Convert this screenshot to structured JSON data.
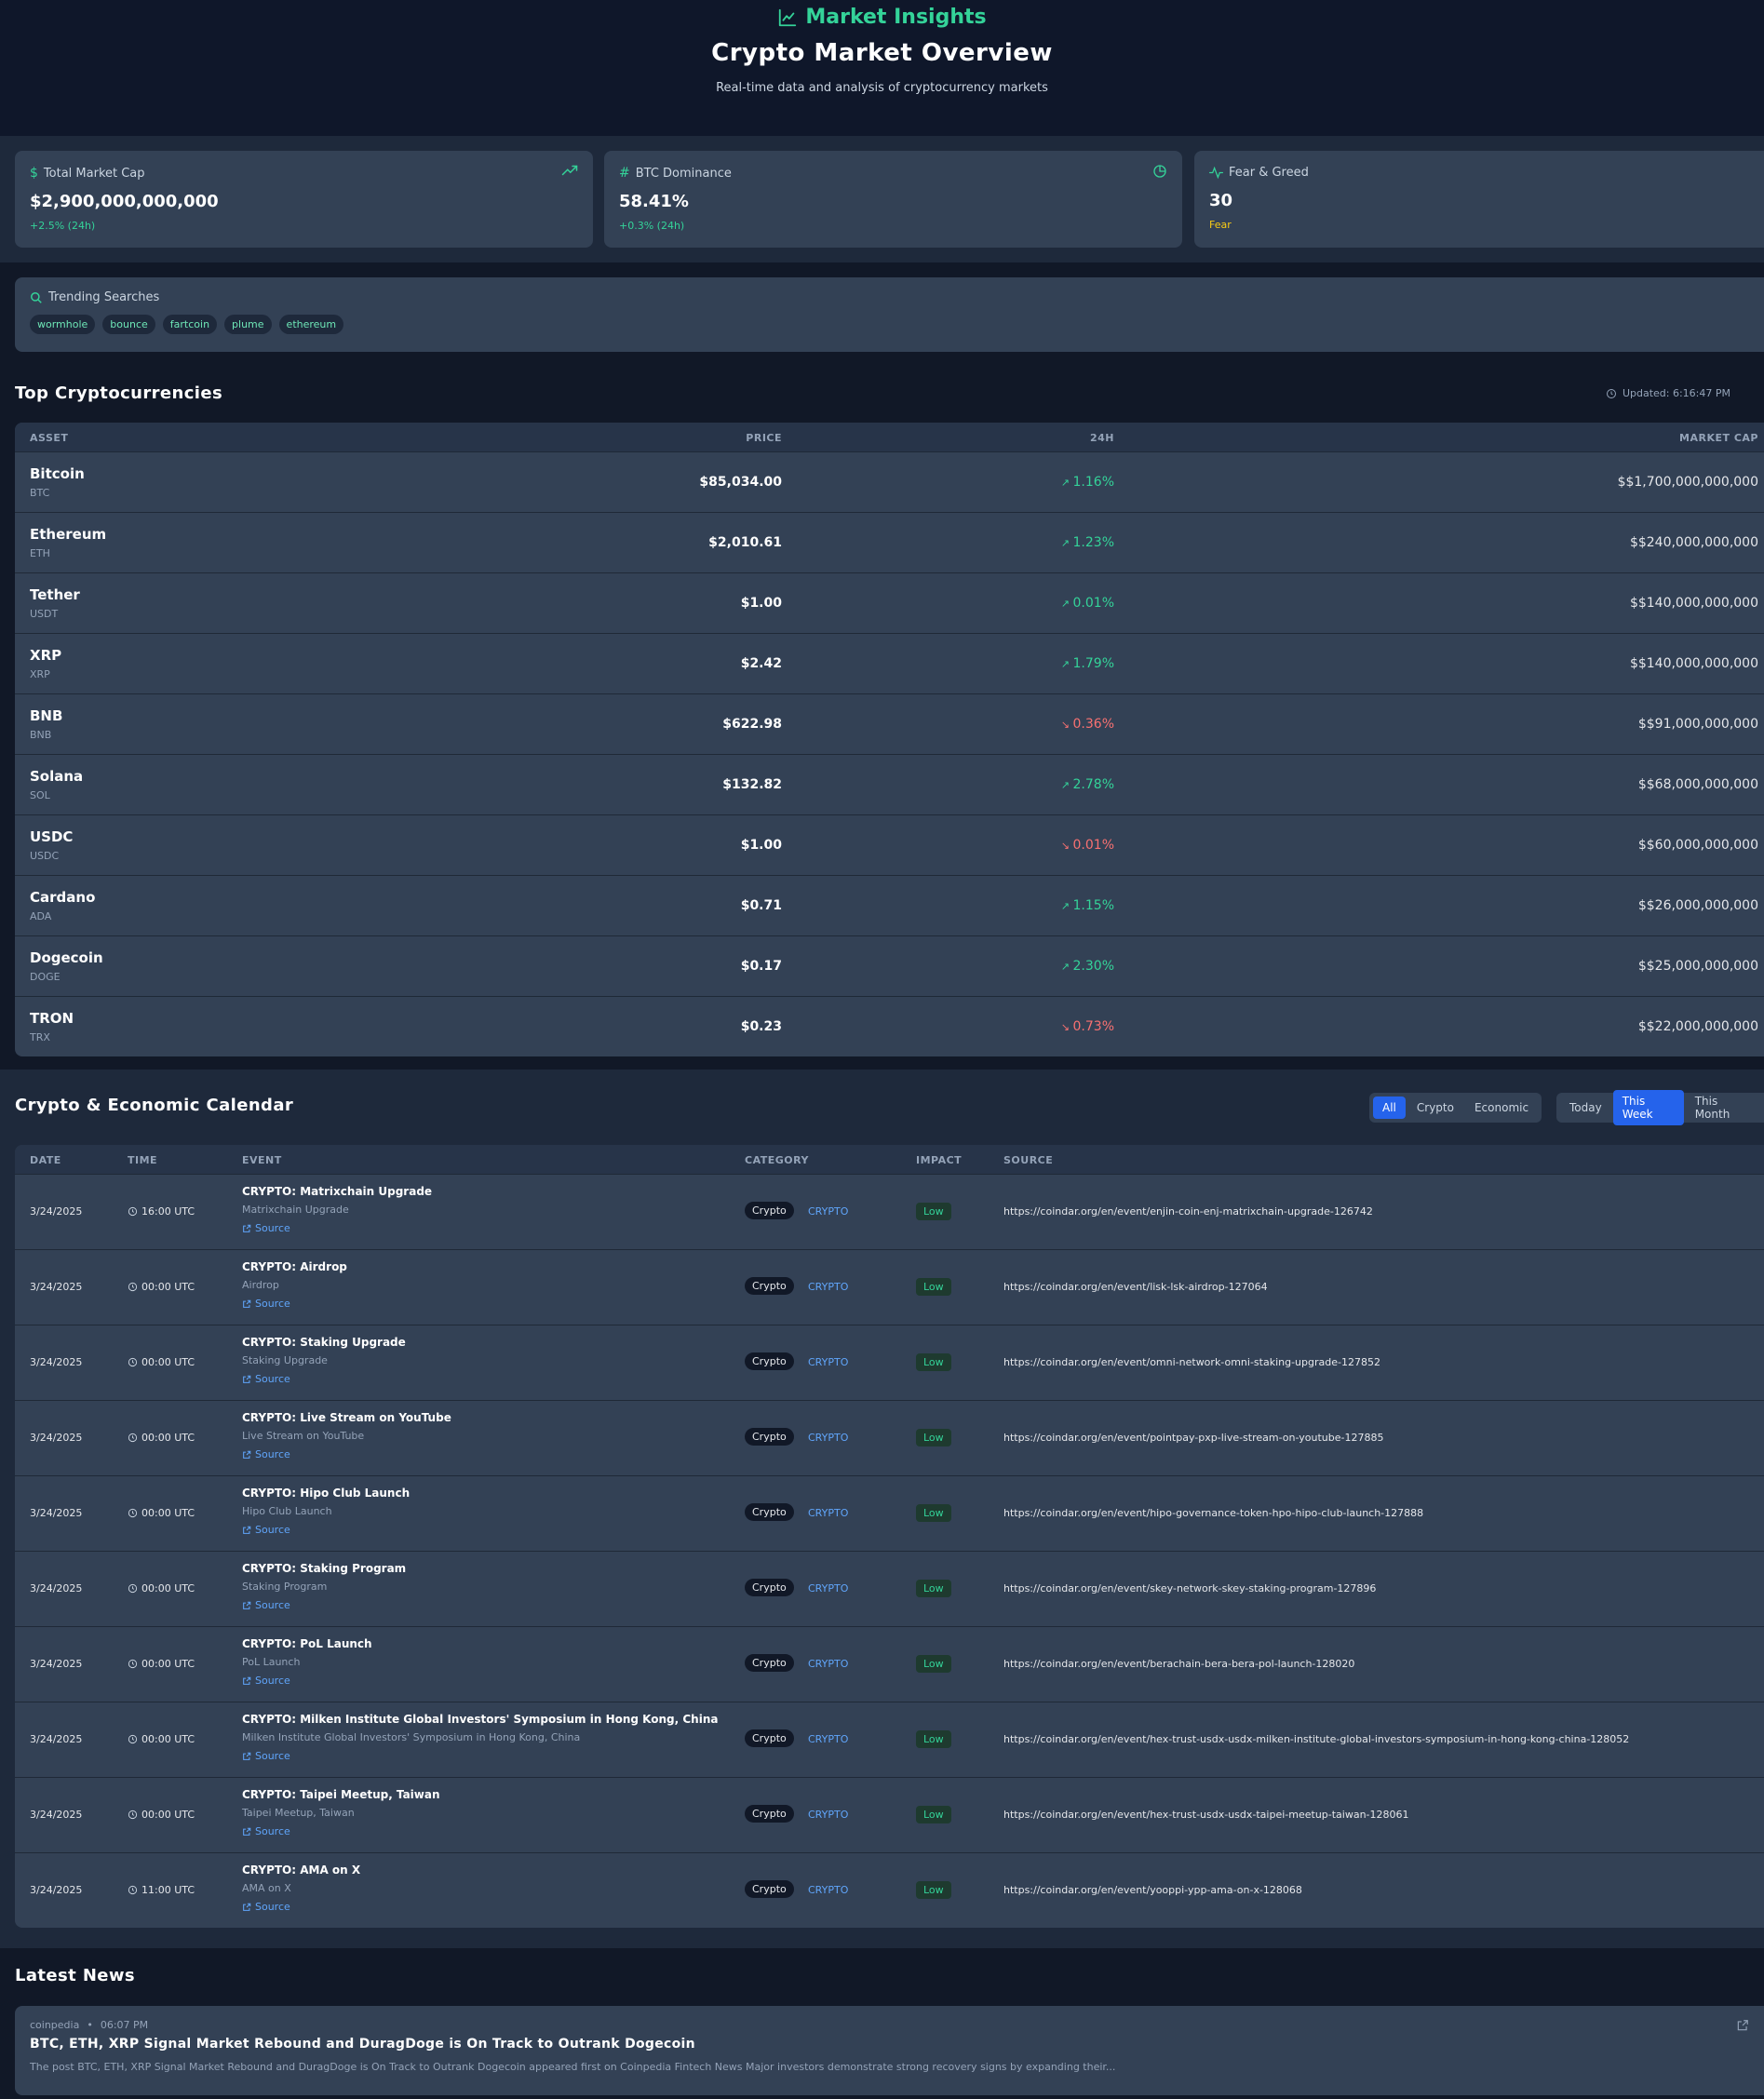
{
  "header": {
    "brand": "Market Insights",
    "title": "Crypto Market Overview",
    "subtitle": "Real-time data and analysis of cryptocurrency markets"
  },
  "stats": [
    {
      "label": "Total Market Cap",
      "value": "$2,900,000,000,000",
      "change": "+2.5% (24h)"
    },
    {
      "label": "BTC Dominance",
      "value": "58.41%",
      "change": "+0.3% (24h)"
    },
    {
      "label": "Fear & Greed",
      "value": "30",
      "change": "Fear"
    }
  ],
  "trending": {
    "label": "Trending Searches",
    "tags": [
      "wormhole",
      "bounce",
      "fartcoin",
      "plume",
      "ethereum"
    ]
  },
  "top_crypto": {
    "title": "Top Cryptocurrencies",
    "updated": "Updated: 6:16:47 PM",
    "headers": {
      "asset": "ASSET",
      "price": "PRICE",
      "change": "24H",
      "cap": "MARKET CAP"
    },
    "rows": [
      {
        "name": "Bitcoin",
        "symbol": "BTC",
        "price": "$85,034.00",
        "change": "1.16%",
        "direction": "up",
        "cap": "$$1,700,000,000,000"
      },
      {
        "name": "Ethereum",
        "symbol": "ETH",
        "price": "$2,010.61",
        "change": "1.23%",
        "direction": "up",
        "cap": "$$240,000,000,000"
      },
      {
        "name": "Tether",
        "symbol": "USDT",
        "price": "$1.00",
        "change": "0.01%",
        "direction": "up",
        "cap": "$$140,000,000,000"
      },
      {
        "name": "XRP",
        "symbol": "XRP",
        "price": "$2.42",
        "change": "1.79%",
        "direction": "up",
        "cap": "$$140,000,000,000"
      },
      {
        "name": "BNB",
        "symbol": "BNB",
        "price": "$622.98",
        "change": "0.36%",
        "direction": "down",
        "cap": "$$91,000,000,000"
      },
      {
        "name": "Solana",
        "symbol": "SOL",
        "price": "$132.82",
        "change": "2.78%",
        "direction": "up",
        "cap": "$$68,000,000,000"
      },
      {
        "name": "USDC",
        "symbol": "USDC",
        "price": "$1.00",
        "change": "0.01%",
        "direction": "down",
        "cap": "$$60,000,000,000"
      },
      {
        "name": "Cardano",
        "symbol": "ADA",
        "price": "$0.71",
        "change": "1.15%",
        "direction": "up",
        "cap": "$$26,000,000,000"
      },
      {
        "name": "Dogecoin",
        "symbol": "DOGE",
        "price": "$0.17",
        "change": "2.30%",
        "direction": "up",
        "cap": "$$25,000,000,000"
      },
      {
        "name": "TRON",
        "symbol": "TRX",
        "price": "$0.23",
        "change": "0.73%",
        "direction": "down",
        "cap": "$$22,000,000,000"
      }
    ]
  },
  "calendar": {
    "title": "Crypto & Economic Calendar",
    "type_filters": [
      {
        "label": "All",
        "active": true
      },
      {
        "label": "Crypto",
        "active": false
      },
      {
        "label": "Economic",
        "active": false
      }
    ],
    "range_filters": [
      {
        "label": "Today",
        "active": false
      },
      {
        "label": "This Week",
        "active": true
      },
      {
        "label": "This Month",
        "active": false
      }
    ],
    "headers": {
      "date": "DATE",
      "time": "TIME",
      "event": "EVENT",
      "category": "CATEGORY",
      "impact": "IMPACT",
      "source": "SOURCE"
    },
    "source_label": "Source",
    "rows": [
      {
        "date": "3/24/2025",
        "time": "16:00 UTC",
        "title": "CRYPTO: Matrixchain Upgrade",
        "desc": "Matrixchain Upgrade",
        "category": "Crypto",
        "type": "CRYPTO",
        "impact": "Low",
        "url": "https://coindar.org/en/event/enjin-coin-enj-matrixchain-upgrade-126742"
      },
      {
        "date": "3/24/2025",
        "time": "00:00 UTC",
        "title": "CRYPTO: Airdrop",
        "desc": "Airdrop",
        "category": "Crypto",
        "type": "CRYPTO",
        "impact": "Low",
        "url": "https://coindar.org/en/event/lisk-lsk-airdrop-127064"
      },
      {
        "date": "3/24/2025",
        "time": "00:00 UTC",
        "title": "CRYPTO: Staking Upgrade",
        "desc": "Staking Upgrade",
        "category": "Crypto",
        "type": "CRYPTO",
        "impact": "Low",
        "url": "https://coindar.org/en/event/omni-network-omni-staking-upgrade-127852"
      },
      {
        "date": "3/24/2025",
        "time": "00:00 UTC",
        "title": "CRYPTO: Live Stream on YouTube",
        "desc": "Live Stream on YouTube",
        "category": "Crypto",
        "type": "CRYPTO",
        "impact": "Low",
        "url": "https://coindar.org/en/event/pointpay-pxp-live-stream-on-youtube-127885"
      },
      {
        "date": "3/24/2025",
        "time": "00:00 UTC",
        "title": "CRYPTO: Hipo Club Launch",
        "desc": "Hipo Club Launch",
        "category": "Crypto",
        "type": "CRYPTO",
        "impact": "Low",
        "url": "https://coindar.org/en/event/hipo-governance-token-hpo-hipo-club-launch-127888"
      },
      {
        "date": "3/24/2025",
        "time": "00:00 UTC",
        "title": "CRYPTO: Staking Program",
        "desc": "Staking Program",
        "category": "Crypto",
        "type": "CRYPTO",
        "impact": "Low",
        "url": "https://coindar.org/en/event/skey-network-skey-staking-program-127896"
      },
      {
        "date": "3/24/2025",
        "time": "00:00 UTC",
        "title": "CRYPTO: PoL Launch",
        "desc": "PoL Launch",
        "category": "Crypto",
        "type": "CRYPTO",
        "impact": "Low",
        "url": "https://coindar.org/en/event/berachain-bera-bera-pol-launch-128020"
      },
      {
        "date": "3/24/2025",
        "time": "00:00 UTC",
        "title": "CRYPTO: Milken Institute Global Investors' Symposium in Hong Kong, China",
        "desc": "Milken Institute Global Investors' Symposium in Hong Kong, China",
        "category": "Crypto",
        "type": "CRYPTO",
        "impact": "Low",
        "url": "https://coindar.org/en/event/hex-trust-usdx-usdx-milken-institute-global-investors-symposium-in-hong-kong-china-128052"
      },
      {
        "date": "3/24/2025",
        "time": "00:00 UTC",
        "title": "CRYPTO: Taipei Meetup, Taiwan",
        "desc": "Taipei Meetup, Taiwan",
        "category": "Crypto",
        "type": "CRYPTO",
        "impact": "Low",
        "url": "https://coindar.org/en/event/hex-trust-usdx-usdx-taipei-meetup-taiwan-128061"
      },
      {
        "date": "3/24/2025",
        "time": "11:00 UTC",
        "title": "CRYPTO: AMA on X",
        "desc": "AMA on X",
        "category": "Crypto",
        "type": "CRYPTO",
        "impact": "Low",
        "url": "https://coindar.org/en/event/yooppi-ypp-ama-on-x-128068"
      }
    ]
  },
  "news": {
    "title": "Latest News",
    "items": [
      {
        "source": "coinpedia",
        "time": "06:07 PM",
        "headline": "BTC, ETH, XRP Signal Market Rebound and DuragDoge is On Track to Outrank Dogecoin",
        "excerpt": "The post BTC, ETH, XRP Signal Market Rebound and DuragDoge is On Track to Outrank Dogecoin appeared first on Coinpedia Fintech News Major investors demonstrate strong recovery signs by expanding their..."
      }
    ]
  },
  "colors": {
    "accent": "#34d399",
    "negative": "#f87171",
    "link": "#60a5fa",
    "active": "#2563eb"
  }
}
